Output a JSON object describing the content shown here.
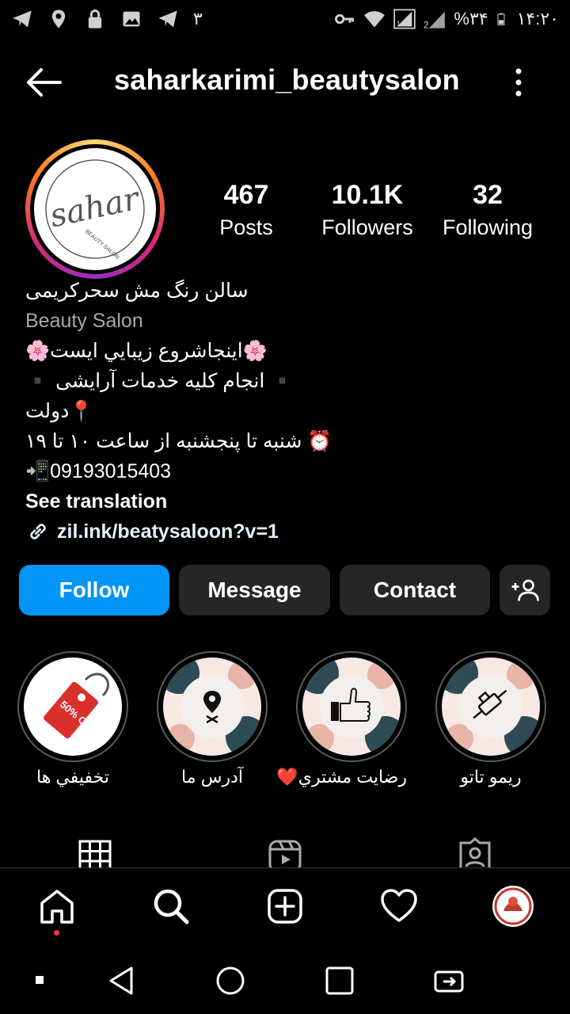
{
  "status_bar": {
    "left_number": "۳",
    "battery_percent": "%۳۴",
    "time": "۱۴:۲۰",
    "sim1": "1",
    "sim2": "2"
  },
  "header": {
    "username": "saharkarimi_beautysalon"
  },
  "profile": {
    "avatar_logo_text": "sahar",
    "avatar_logo_subtext": "BEAUTY SALON",
    "stats": [
      {
        "value": "467",
        "label": "Posts"
      },
      {
        "value": "10.1K",
        "label": "Followers"
      },
      {
        "value": "32",
        "label": "Following"
      }
    ],
    "bio": {
      "name": "سالن رنگ مش سحرکریمی",
      "category": "Beauty Salon",
      "line1": "🌸اینجاشروع زيبايي ايست🌸",
      "line2": "▪️ انجام کلیه خدمات آرایشی ▪️",
      "line3": "📍دولت",
      "line4": "⏰ شنبه تا پنجشنبه از ساعت ۱۰ تا ۱۹",
      "line5": "📲09193015403",
      "see_translation": "See translation",
      "link": "zil.ink/beatysaloon?v=1"
    }
  },
  "actions": {
    "follow": "Follow",
    "message": "Message",
    "contact": "Contact"
  },
  "highlights": [
    {
      "label": "تخفيفي ها",
      "badge": "50% OFF"
    },
    {
      "label": "آدرس ما"
    },
    {
      "label": "رضايت مشتري❤️"
    },
    {
      "label": "ريمو تاتو"
    }
  ],
  "colors": {
    "follow_button": "#0095f6",
    "secondary_button": "#262626",
    "background": "#000000",
    "notification_dot": "#ff3040"
  }
}
